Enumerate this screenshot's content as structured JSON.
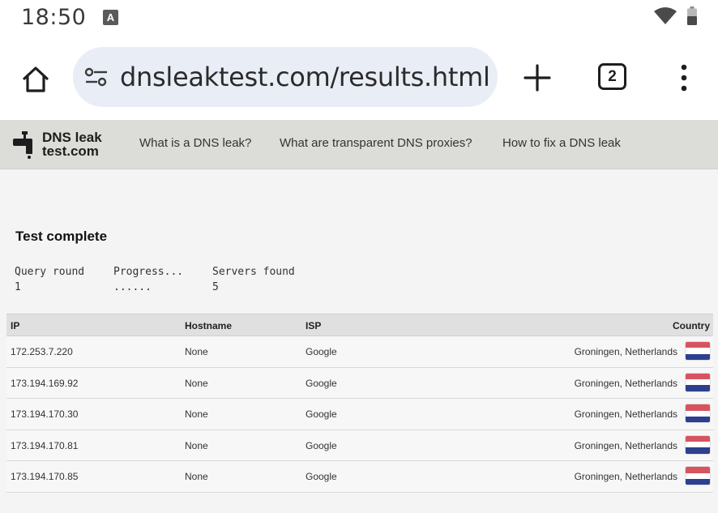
{
  "status_bar": {
    "time": "18:50",
    "notification_letter": "A"
  },
  "browser": {
    "url": "dnsleaktest.com/results.html",
    "tab_count": "2"
  },
  "site": {
    "logo_line1": "DNS leak",
    "logo_line2": "test.com",
    "nav": [
      "What is a DNS leak?",
      "What are transparent DNS proxies?",
      "How to fix a DNS leak"
    ]
  },
  "results": {
    "title": "Test complete",
    "stats": [
      {
        "label": "Query round",
        "value": "1"
      },
      {
        "label": "Progress...",
        "value": "......"
      },
      {
        "label": "Servers found",
        "value": "5"
      }
    ],
    "columns": {
      "ip": "IP",
      "hostname": "Hostname",
      "isp": "ISP",
      "country": "Country"
    },
    "rows": [
      {
        "ip": "172.253.7.220",
        "hostname": "None",
        "isp": "Google",
        "country": "Groningen, Netherlands"
      },
      {
        "ip": "173.194.169.92",
        "hostname": "None",
        "isp": "Google",
        "country": "Groningen, Netherlands"
      },
      {
        "ip": "173.194.170.30",
        "hostname": "None",
        "isp": "Google",
        "country": "Groningen, Netherlands"
      },
      {
        "ip": "173.194.170.81",
        "hostname": "None",
        "isp": "Google",
        "country": "Groningen, Netherlands"
      },
      {
        "ip": "173.194.170.85",
        "hostname": "None",
        "isp": "Google",
        "country": "Groningen, Netherlands"
      }
    ],
    "flag_colors": [
      "#d7545f",
      "#ffffff",
      "#2e3f8f"
    ]
  }
}
